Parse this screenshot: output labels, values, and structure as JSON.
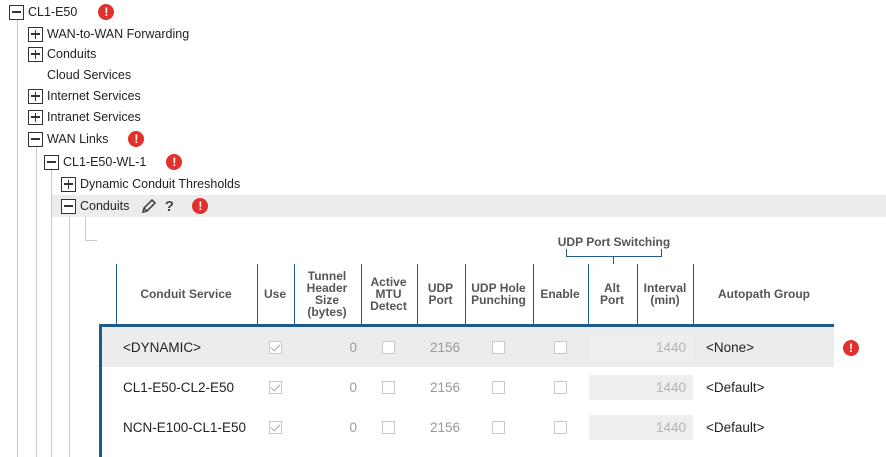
{
  "tree": {
    "root": {
      "label": "CL1-E50",
      "error": "!"
    },
    "items": [
      {
        "label": "WAN-to-WAN Forwarding"
      },
      {
        "label": "Conduits"
      },
      {
        "label": "Cloud Services"
      },
      {
        "label": "Internet Services"
      },
      {
        "label": "Intranet Services"
      },
      {
        "label": "WAN Links",
        "error": "!"
      },
      {
        "label": "CL1-E50-WL-1",
        "error": "!"
      },
      {
        "label": "Dynamic Conduit Thresholds"
      },
      {
        "label": "Conduits",
        "error": "!",
        "help": "?"
      }
    ]
  },
  "table": {
    "group_header": "UDP Port Switching",
    "headers": {
      "conduit_service": "Conduit Service",
      "use": "Use",
      "tunnel_header": [
        "Tunnel",
        "Header",
        "Size",
        "(bytes)"
      ],
      "active_mtu": [
        "Active",
        "MTU",
        "Detect"
      ],
      "udp_port": [
        "UDP",
        "Port"
      ],
      "udp_hole": [
        "UDP Hole",
        "Punching"
      ],
      "enable": "Enable",
      "alt_port": [
        "Alt",
        "Port"
      ],
      "interval": [
        "Interval",
        "(min)"
      ],
      "autopath": "Autopath Group"
    },
    "rows": [
      {
        "service": "<DYNAMIC>",
        "use": true,
        "tunnel_size": "0",
        "mtu": false,
        "udp_port": "2156",
        "hole_punch": false,
        "enable": false,
        "alt_port": "",
        "interval": "1440",
        "autopath": "<None>",
        "error": "!",
        "selected": true
      },
      {
        "service": "CL1-E50-CL2-E50",
        "use": true,
        "tunnel_size": "0",
        "mtu": false,
        "udp_port": "2156",
        "hole_punch": false,
        "enable": false,
        "alt_port": "",
        "interval": "1440",
        "autopath": "<Default>"
      },
      {
        "service": "NCN-E100-CL1-E50",
        "use": true,
        "tunnel_size": "0",
        "mtu": false,
        "udp_port": "2156",
        "hole_punch": false,
        "enable": false,
        "alt_port": "",
        "interval": "1440",
        "autopath": "<Default>"
      }
    ]
  }
}
